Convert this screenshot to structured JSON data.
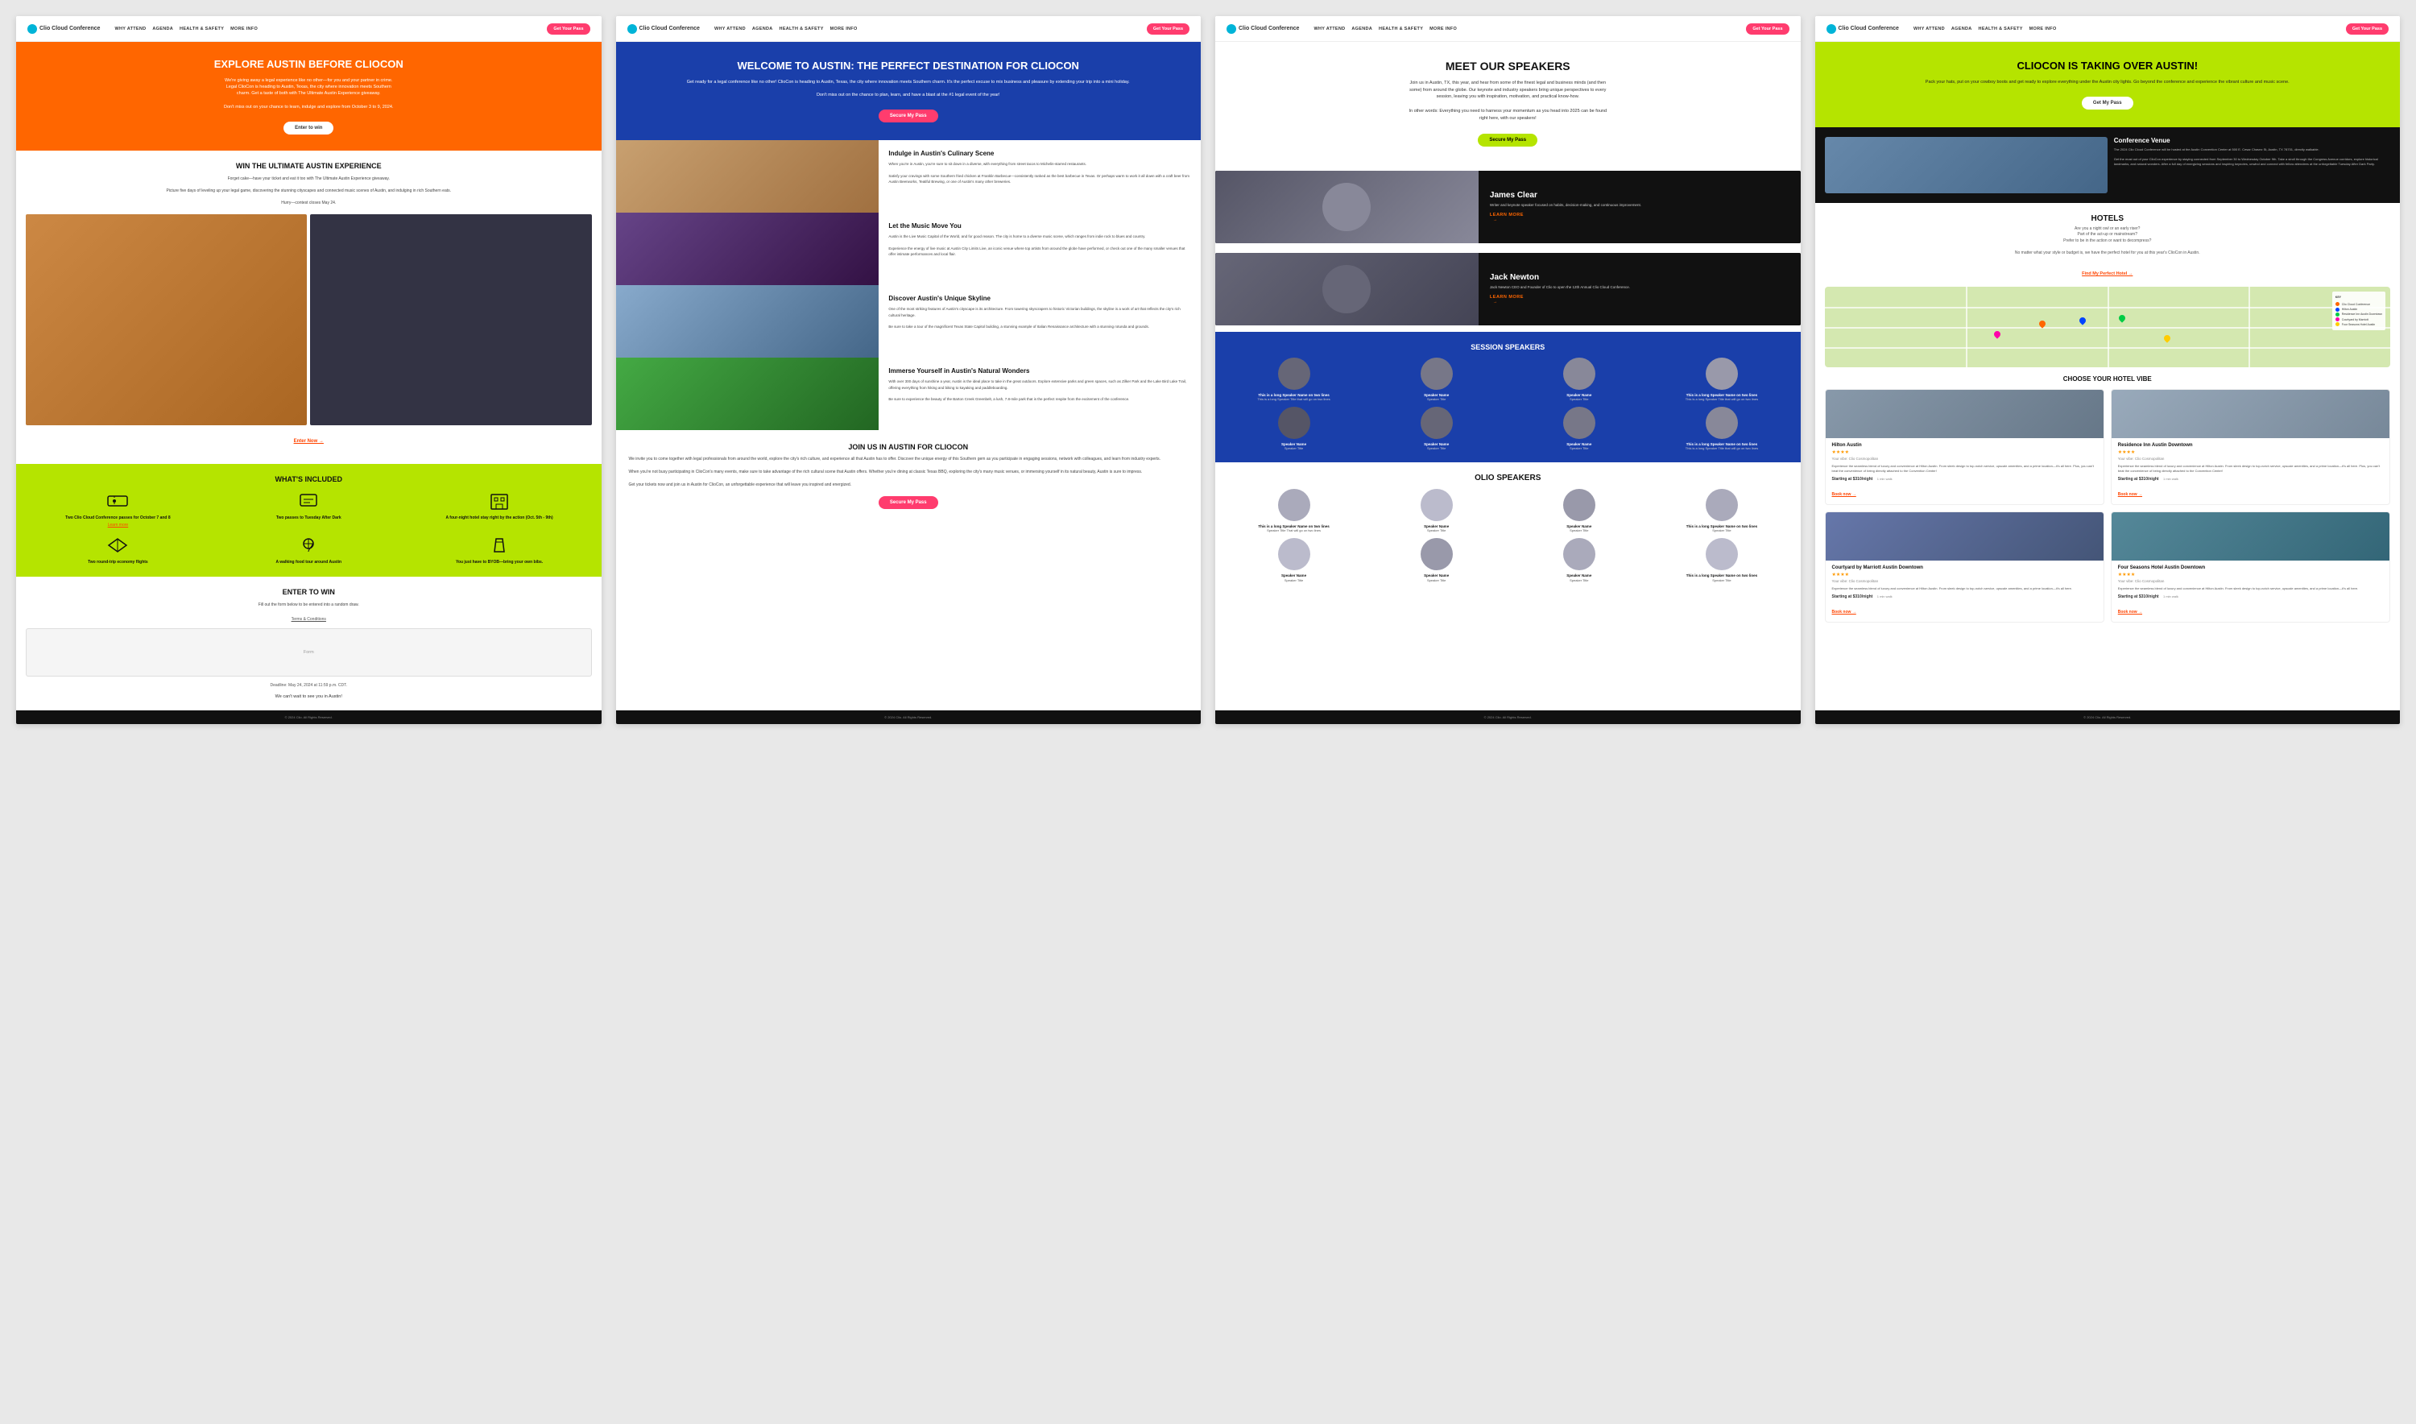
{
  "pages": [
    {
      "id": "page1",
      "nav": {
        "logo": "Clio Cloud Conference",
        "links": [
          "WHY ATTEND",
          "AGENDA",
          "HEALTH & SAFETY",
          "MORE INFO"
        ],
        "cta": "Get Your Pass"
      },
      "hero": {
        "title": "EXPLORE AUSTIN BEFORE CLIOCON",
        "body": "We're giving away a legal experience like no other—for you and your partner in crime. Legal ClioCon is heading to Austin, Texas, the city where innovation meets Southern charm. Get a taste of both with The Ultimate Austin Experience giveaway.\n\nDon't miss out on your chance to learn, indulge and explore from October 3 to 9, 2024.",
        "cta": "Enter to win"
      },
      "win_section": {
        "title": "WIN THE ULTIMATE AUSTIN EXPERIENCE",
        "body": "Forget cake—have your ticket and eat it too with The Ultimate Austin Experience giveaway.\n\nPicture five days of leveling up your legal game, discovering the stunning cityscapes and connected music scenes of Austin, and indulging in rich Southern eats.\n\nHurry—contest closes May 24."
      },
      "whats_included": {
        "title": "WHAT'S INCLUDED",
        "items": [
          {
            "icon": "ticket-icon",
            "label": "Two Clio Cloud Conference passes for October 7 and 8",
            "link": "Learn more"
          },
          {
            "icon": "pass-icon",
            "label": "Two passes to Tuesday After Dark",
            "link": ""
          },
          {
            "icon": "hotel-icon",
            "label": "A four-night hotel stay right by the action (Oct. 5th - 9th)",
            "link": ""
          },
          {
            "icon": "plane-icon",
            "label": "Two round-trip economy flights",
            "link": ""
          },
          {
            "icon": "food-tour-icon",
            "label": "A walking food tour around Austin",
            "link": ""
          },
          {
            "icon": "byob-icon",
            "label": "You just have to BYOB—bring your own bibs.",
            "link": ""
          }
        ]
      },
      "enter_section": {
        "title": "ENTER TO WIN",
        "subtitle": "Fill out the form below to be entered into a random draw.",
        "terms": "Terms & Conditions",
        "deadline": "Deadline: May 24, 2024 at 11:59 p.m. CDT.",
        "form_label": "Form",
        "cant_wait": "We can't wait to see you in Austin!"
      }
    },
    {
      "id": "page2",
      "nav": {
        "logo": "Clio Cloud Conference",
        "links": [
          "WHY ATTEND",
          "AGENDA",
          "HEALTH & SAFETY",
          "MORE INFO"
        ],
        "cta": "Get Your Pass"
      },
      "hero": {
        "title": "WELCOME TO AUSTIN: THE PERFECT DESTINATION FOR CLIOCON",
        "body": "Get ready for a legal conference like no other! ClioCon is heading to Austin, Texas, the city where innovation meets Southern charm. It's the perfect excuse to mix business and pleasure by extending your trip into a mini holiday.\n\nDon't miss out on the chance to plan, learn, and have a blast at the #1 legal event of the year!",
        "cta": "Secure My Pass"
      },
      "culinary": {
        "title": "Indulge in Austin's Culinary Scene",
        "body": "When you're in Austin, you're sure to sit down in a diverse, with everything from street tacos to Michelin-starred restaurants.\n\nSatisfy your cravings with some Southern fried chicken at Franklin Barbecue—consistently ranked as the best barbecue in Texas. Or perhaps its warm to work it all down with a craft beer from Austin Beerworks, Teatiful Brewing, or one of Austin's many other breweries."
      },
      "music": {
        "title": "Let the Music Move You",
        "body": "Austin is the Live Music Capital of the World, and for good reason. The city is home to a diverse music scene, which ranges from indie rock to blues and country.\n\nExperience the energy of live music at Austin City Limits Live, an iconic venue where top artists from around the globe have performed, or check out one of the many smaller venues that offer intimate performances and local flair."
      },
      "skyline": {
        "title": "Discover Austin's Unique Skyline",
        "body": "One of the most striking features of Austin's cityscape is its architecture. From towering skyscrapers to historic Victorian buildings, the skyline is a work of art that reflects the city's rich cultural heritage.\n\nBe sure to take a tour of the magnificent Texas State Capitol building, a stunning example of Italian Renaissance architecture with a stunning rotunda and grounds."
      },
      "nature": {
        "title": "Immerse Yourself in Austin's Natural Wonders",
        "body": "With over 300 days of sunshine a year, Austin is the ideal place to take in the great outdoors. Explore extensive parks and green spaces, such as Zilker Park and the Lake Bird Lake Trail, offering everything from hiking and biking to kayaking and paddleboarding.\n\nBe sure to experience the beauty of the Barton Creek Greenbelt, a lush, 7.8-mile park that is the perfect respite from the excitement of the conference."
      },
      "join": {
        "title": "JOIN US IN AUSTIN FOR CLIOCON",
        "body": "We invite you to come together with legal professionals from around the world, explore the city's rich culture, and experience all that Austin has to offer. Discover the unique energy of this Southern gem as you participate in engaging sessions, network with colleagues, and learn from industry experts.\n\nWhen you're not busy participating in ClioCon's many events, make sure to take advantage of the rich cultural scene that Austin offers. Whether you're dining at classic Texas BBQ, exploring the city's many music venues, or immersing yourself in its natural beauty, Austin is sure to impress.\n\nGet your tickets now and join us in Austin for ClioCon, an unforgettable experience that will leave you inspired and energized.",
        "cta": "Secure My Pass"
      }
    },
    {
      "id": "page3",
      "nav": {
        "logo": "Clio Cloud Conference",
        "links": [
          "WHY ATTEND",
          "AGENDA",
          "HEALTH & SAFETY",
          "MORE INFO"
        ],
        "cta": "Get Your Pass"
      },
      "hero": {
        "title": "MEET OUR SPEAKERS",
        "body": "Join us in Austin, TX, this year, and hear from some of the finest legal and business minds (and then some) from around the globe. Our keynote and industry speakers bring unique perspectives to every session, leaving you with inspiration, motivation, and practical know-how.\n\nIn other words: Everything you need to harness your momentum as you head into 2025 can be found right here, with our speakers!",
        "cta": "Secure My Pass"
      },
      "featured_speakers": [
        {
          "name": "James Clear",
          "title": "Writer and keynote speaker focused on habits, decision-making, and continuous improvement.",
          "cta": "LEARN MORE"
        },
        {
          "name": "Jack Newton",
          "title": "Jack Newton CEO and Founder of Clio to open the 12th Annual Clio Cloud Conference.",
          "cta": "LEARN MORE"
        }
      ],
      "session_speakers": {
        "title": "SESSION SPEAKERS",
        "speakers": [
          {
            "name": "This is a long Speaker Name on two lines",
            "title": "This is a long Speaker Title that will go on two lines"
          },
          {
            "name": "Speaker Name",
            "title": "Speaker Title"
          },
          {
            "name": "Speaker Name",
            "title": "Speaker Title"
          },
          {
            "name": "This is a long Speaker Name on two lines",
            "title": "This is a long Speaker Title that will go on two lines"
          },
          {
            "name": "Speaker Name",
            "title": "Speaker Title"
          },
          {
            "name": "Speaker Name",
            "title": "Speaker Title"
          },
          {
            "name": "Speaker Name",
            "title": "Speaker Title"
          },
          {
            "name": "This is a long Speaker Name on two lines",
            "title": "This is a long Speaker Title that will go on two lines"
          }
        ]
      },
      "olio_speakers": {
        "title": "OLIO SPEAKERS",
        "speakers": [
          {
            "name": "This is a long Speaker Name on two lines",
            "title": "Speaker Title That will go on two lines"
          },
          {
            "name": "Speaker Name",
            "title": "Speaker Title"
          },
          {
            "name": "Speaker Name",
            "title": "Speaker Title"
          },
          {
            "name": "This is a long Speaker Name on two lines",
            "title": "Speaker Title"
          },
          {
            "name": "Speaker Name",
            "title": "Speaker Title"
          },
          {
            "name": "Speaker Name",
            "title": "Speaker Title"
          },
          {
            "name": "Speaker Name",
            "title": "Speaker Title"
          },
          {
            "name": "This is a long Speaker Name on two lines",
            "title": "Speaker Title"
          }
        ]
      }
    },
    {
      "id": "page4",
      "nav": {
        "logo": "Clio Cloud Conference",
        "links": [
          "WHY ATTEND",
          "AGENDA",
          "HEALTH & SAFETY",
          "MORE INFO"
        ],
        "cta": "Get Your Pass"
      },
      "hero": {
        "title": "CLIOCON IS TAKING OVER AUSTIN!",
        "body": "Pack your hats, put on your cowboy boots and get ready to explore everything under the Austin city lights. Go beyond the conference and experience the vibrant culture and music scene.",
        "cta": "Get My Pass"
      },
      "venue": {
        "title": "Conference Venue",
        "body": "The 2024 Clio Cloud Conference will be hosted at the Austin Convention Center at 500 E. Cesar Chavez St, Austin, TX 78701, directly walkable.\n\nGet the most out of your ClioCon experience by staying connected from September 30 to Wednesday October 9th. Take a stroll through the Congress Avenue corridors, explore historical landmarks, and natural wonders. After a full day of energizing sessions and inspiring keynotes, unwind and connect with fellow attendees at the unforgettable Tuesday After Dark Party.",
        "address": "Austin Convention Center, 500 E. Cesar Chavez St, Austin TX 78701"
      },
      "hotels": {
        "title": "HOTELS",
        "subtitle": "Are you a night owl or an early riser?\nPart of the act-up or mainstream?\nPrefer to be in the action or want to decompress?\n\nNo matter what your style or budget is, we have the perfect hotel for you at this year's ClioCon in Austin.",
        "find_link": "Find My Perfect Hotel →",
        "map_key": {
          "title": "KEY",
          "items": [
            {
              "color": "#ff6600",
              "label": "Clio Cloud Conference"
            },
            {
              "color": "#0044ff",
              "label": "Hilton Austin"
            },
            {
              "color": "#00cc44",
              "label": "Residence Inn Austin Downtown"
            },
            {
              "color": "#ff00aa",
              "label": "Courtyard by Marriott"
            },
            {
              "color": "#ffcc00",
              "label": "Four Seasons Hotel Austin"
            }
          ]
        }
      },
      "choose_vibe": {
        "title": "Choose Your Hotel Vibe",
        "hotels": [
          {
            "name": "Hilton Austin",
            "stars": "★★★★",
            "vibe": "Your vibe: Clio Cosmopolitan",
            "photo_class": "h1",
            "desc": "Experience the seamless blend of luxury and convenience at Hilton Austin. From sleek design to top-notch service, upscale amenities, and a prime location—it's all here. Plus, you can't beat the convenience of being directly attached to the Convention Center!",
            "price": "Starting at $310/night",
            "dist": "1 min walk",
            "book": "Book now →"
          },
          {
            "name": "Residence Inn Austin Downtown",
            "stars": "★★★★",
            "vibe": "Your vibe: Clio Cosmopolitan",
            "photo_class": "h2",
            "desc": "Experience the seamless blend of luxury and convenience at Hilton Austin. From sleek design to top-notch service, upscale amenities, and a prime location—it's all here. Plus, you can't beat the convenience of being directly attached to the Convention Center!",
            "price": "Starting at $310/night",
            "dist": "1 min walk",
            "book": "Book now →"
          },
          {
            "name": "Courtyard by Marriott Austin Downtown",
            "stars": "★★★★",
            "vibe": "Your vibe: Clio Cosmopolitan",
            "photo_class": "h3",
            "desc": "Experience the seamless blend of luxury and convenience at Hilton Austin. From sleek design to top-notch service, upscale amenities, and a prime location—it's all here.",
            "price": "Starting at $310/night",
            "dist": "1 min walk",
            "book": "Book now →"
          },
          {
            "name": "Four Seasons Hotel Austin Downtown",
            "stars": "★★★★",
            "vibe": "Your vibe: Clio Cosmopolitan",
            "photo_class": "h4",
            "desc": "Experience the seamless blend of luxury and convenience at Hilton Austin. From sleek design to top-notch service, upscale amenities, and a prime location—it's all here.",
            "price": "Starting at $310/night",
            "dist": "1 min walk",
            "book": "Book now →"
          }
        ]
      }
    }
  ]
}
